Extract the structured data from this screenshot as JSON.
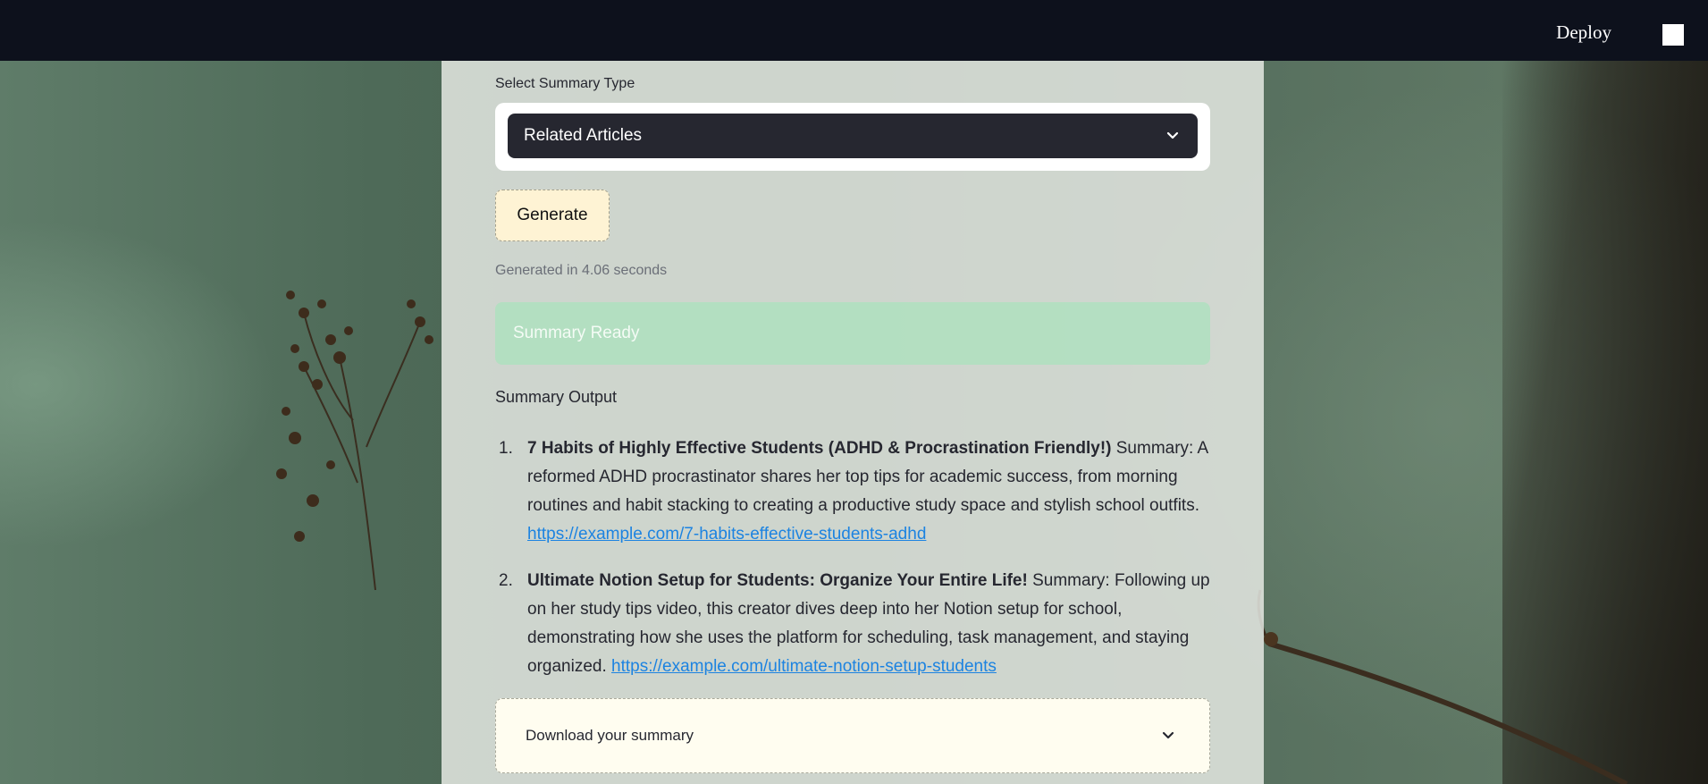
{
  "header": {
    "deploy_label": "Deploy",
    "menu_icon": "menu-square-icon"
  },
  "form": {
    "select_label": "Select Summary Type",
    "select_value": "Related Articles",
    "generate_label": "Generate",
    "generated_time": "Generated in 4.06 seconds"
  },
  "status": {
    "success_text": "Summary Ready",
    "success_color": "#ace1be"
  },
  "output": {
    "title": "Summary Output",
    "articles": [
      {
        "number": "1.",
        "title": "7 Habits of Highly Effective Students (ADHD & Procrastination Friendly!)",
        "summary": " Summary: A reformed ADHD procrastinator shares her top tips for academic success, from morning routines and habit stacking to creating a productive study space and stylish school outfits. ",
        "link": "https://example.com/7-habits-effective-students-adhd"
      },
      {
        "number": "2.",
        "title": "Ultimate Notion Setup for Students: Organize Your Entire Life!",
        "summary": " Summary: Following up on her study tips video, this creator dives deep into her Notion setup for school, demonstrating how she uses the platform for scheduling, task management, and staying organized. ",
        "link": "https://example.com/ultimate-notion-setup-students"
      }
    ]
  },
  "download": {
    "label": "Download your summary"
  },
  "colors": {
    "topbar": "#0d111c",
    "select_bg": "#262730",
    "button_bg": "#fef3d4",
    "link": "#1c83e1"
  }
}
